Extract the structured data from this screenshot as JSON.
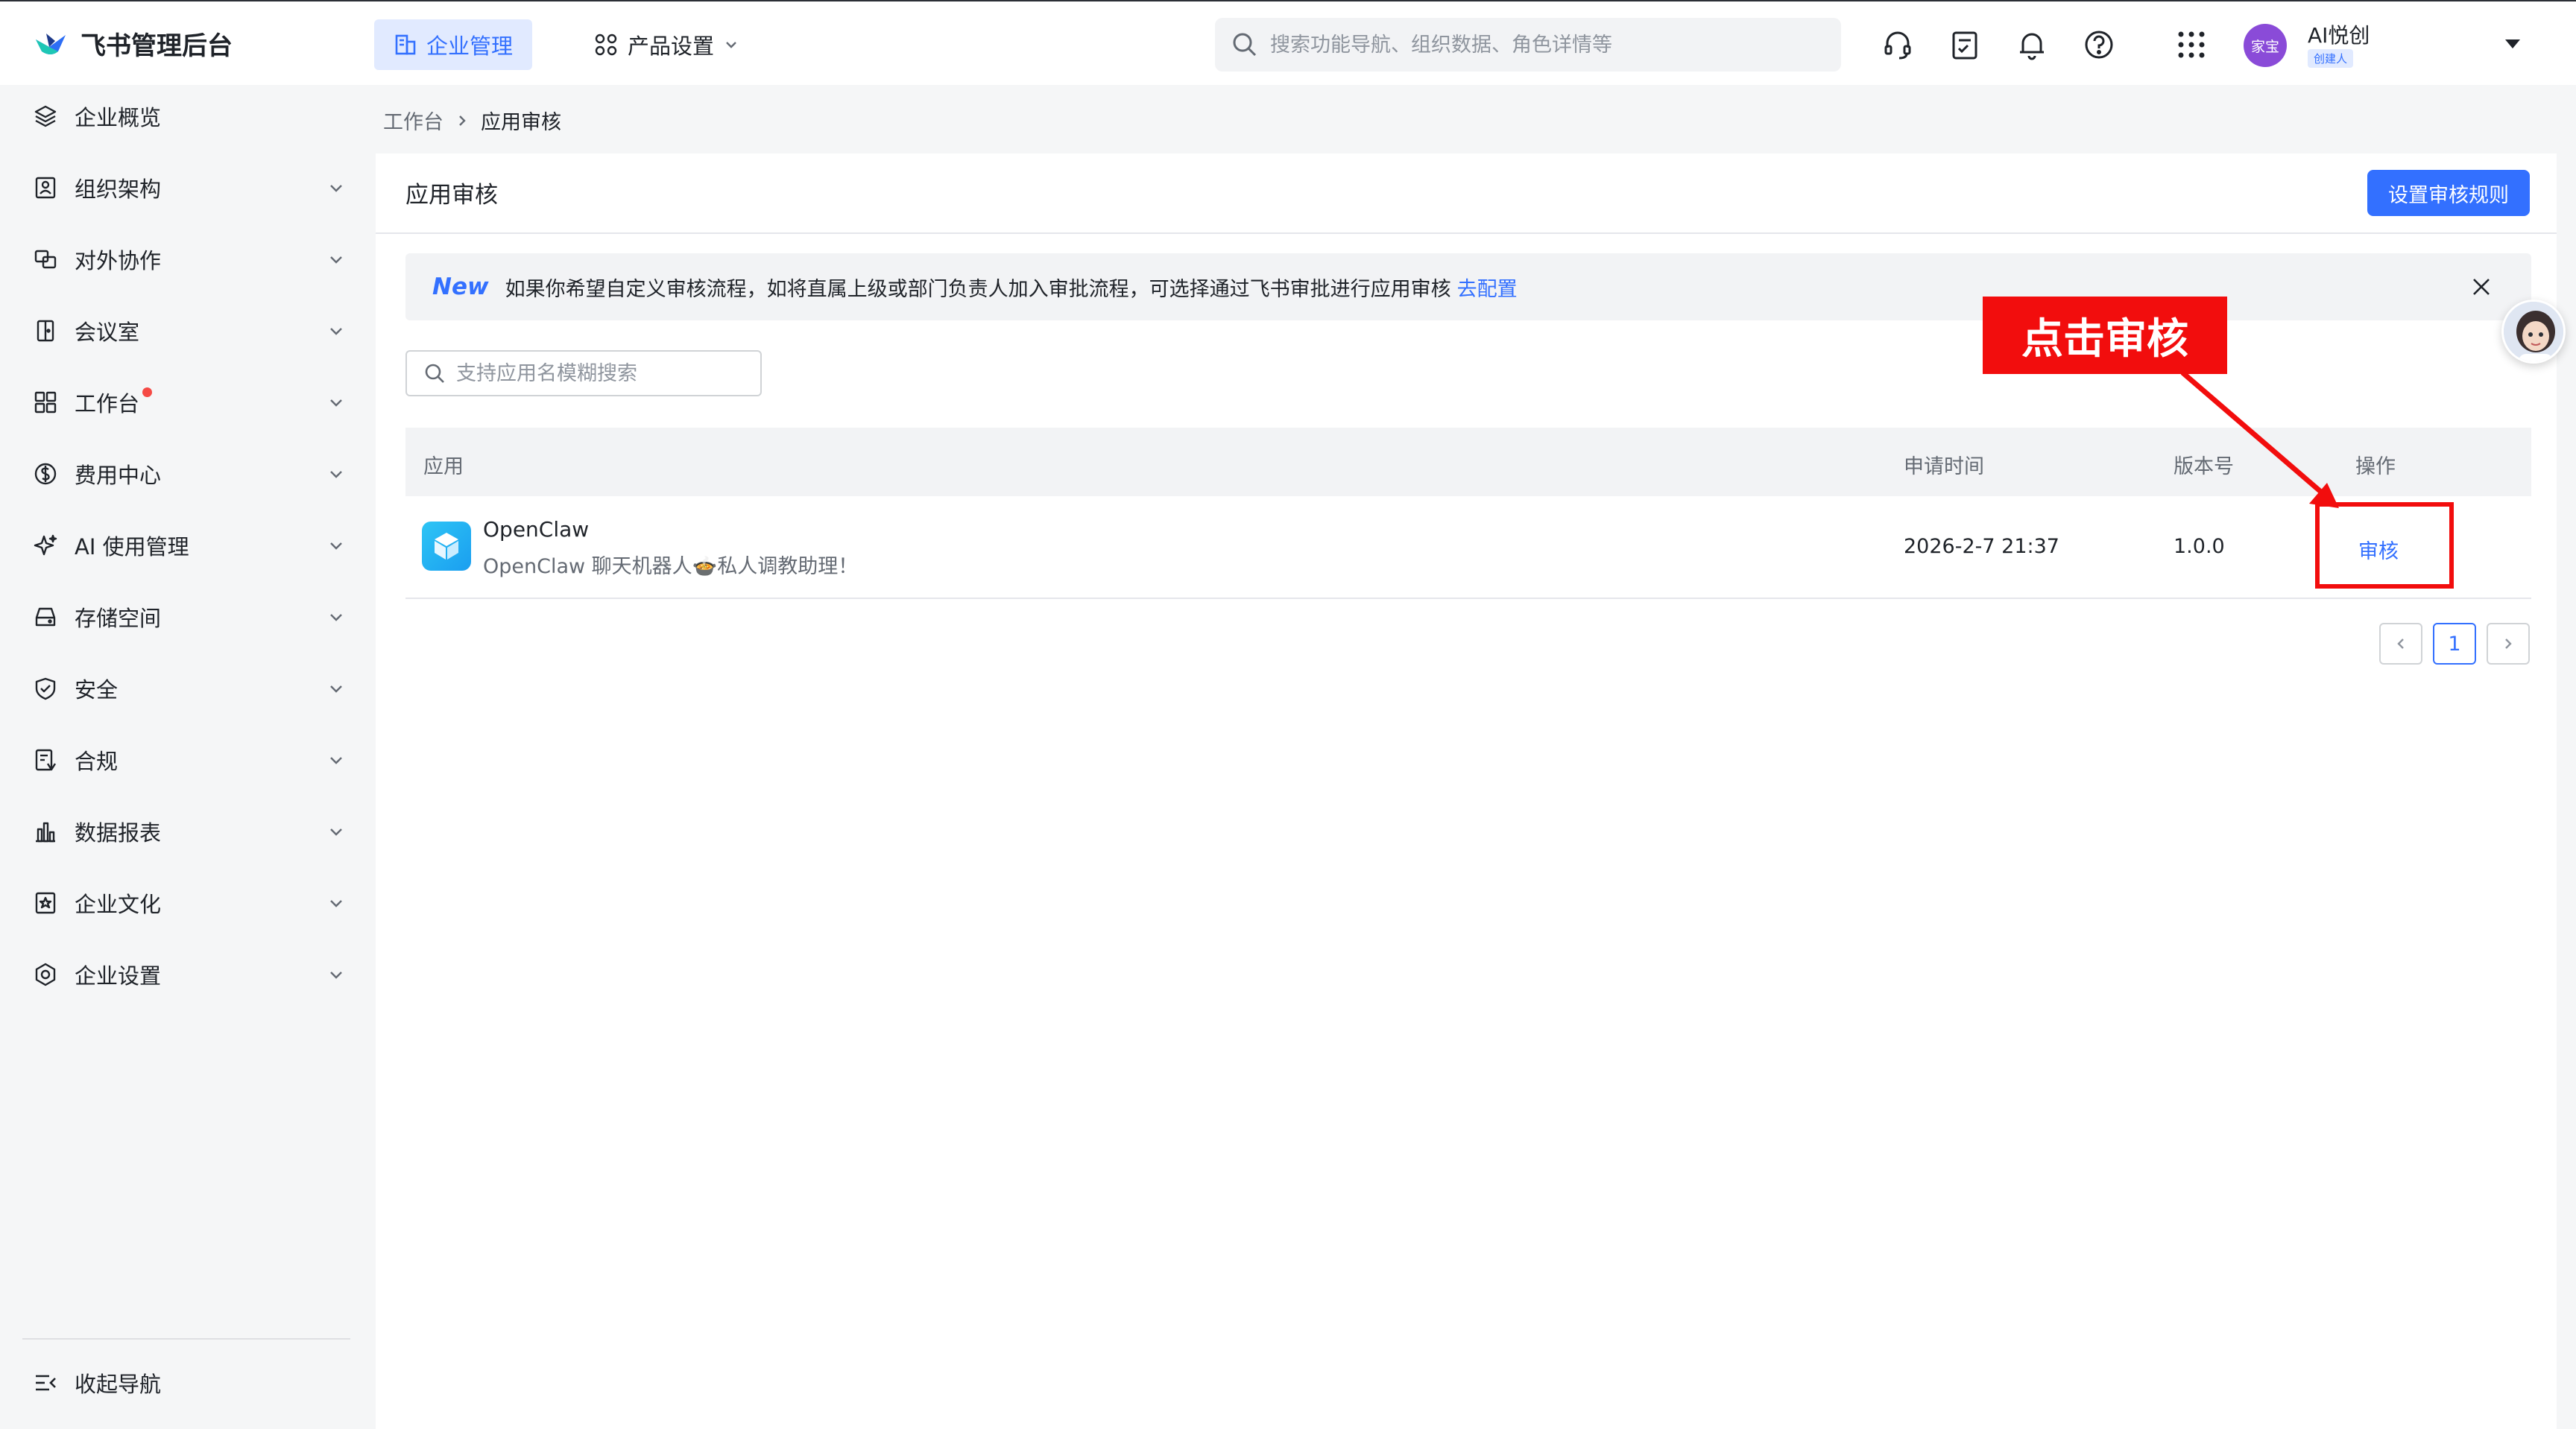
{
  "header": {
    "app_title": "飞书管理后台",
    "tabs": [
      {
        "label": "企业管理",
        "active": true
      },
      {
        "label": "产品设置",
        "active": false
      }
    ],
    "search_placeholder": "搜索功能导航、组织数据、角色详情等",
    "icons": [
      "headset-icon",
      "checklist-icon",
      "bell-icon",
      "help-icon",
      "apps-grid-icon"
    ],
    "user": {
      "avatar_text": "家宝",
      "name": "AI悦创",
      "role": "创建人"
    }
  },
  "sidebar": {
    "items": [
      {
        "label": "企业概览",
        "icon": "layers-icon",
        "has_chevron": false
      },
      {
        "label": "组织架构",
        "icon": "org-chart-icon",
        "has_chevron": true
      },
      {
        "label": "对外协作",
        "icon": "collaboration-icon",
        "has_chevron": true
      },
      {
        "label": "会议室",
        "icon": "meeting-room-icon",
        "has_chevron": true
      },
      {
        "label": "工作台",
        "icon": "workspace-grid-icon",
        "has_chevron": true,
        "badge_dot": true
      },
      {
        "label": "费用中心",
        "icon": "dollar-icon",
        "has_chevron": true
      },
      {
        "label": "AI 使用管理",
        "icon": "sparkle-icon",
        "has_chevron": true
      },
      {
        "label": "存储空间",
        "icon": "storage-icon",
        "has_chevron": true
      },
      {
        "label": "安全",
        "icon": "shield-icon",
        "has_chevron": true
      },
      {
        "label": "合规",
        "icon": "compliance-icon",
        "has_chevron": true
      },
      {
        "label": "数据报表",
        "icon": "bar-chart-icon",
        "has_chevron": true
      },
      {
        "label": "企业文化",
        "icon": "culture-icon",
        "has_chevron": true
      },
      {
        "label": "企业设置",
        "icon": "settings-icon",
        "has_chevron": true
      }
    ],
    "collapse_label": "收起导航"
  },
  "breadcrumb": {
    "parent": "工作台",
    "current": "应用审核"
  },
  "page": {
    "title": "应用审核",
    "primary_button": "设置审核规则",
    "notice": {
      "tag": "New",
      "text": "如果你希望自定义审核流程，如将直属上级或部门负责人加入审批流程，可选择通过飞书审批进行应用审核",
      "link": "去配置"
    },
    "filter_placeholder": "支持应用名模糊搜索",
    "table": {
      "columns": [
        "应用",
        "申请时间",
        "版本号",
        "操作"
      ],
      "rows": [
        {
          "app_name": "OpenClaw",
          "description": "OpenClaw 聊天机器人🍲私人调教助理！",
          "time": "2026-2-7 21:37",
          "version": "1.0.0",
          "action": "审核"
        }
      ]
    },
    "pagination": {
      "current_page": "1"
    }
  },
  "annotation": {
    "label": "点击审核",
    "color": "#f20d0d"
  },
  "colors": {
    "accent": "#3370ff",
    "danger": "#f20d0d",
    "badge": "#f54a45"
  }
}
